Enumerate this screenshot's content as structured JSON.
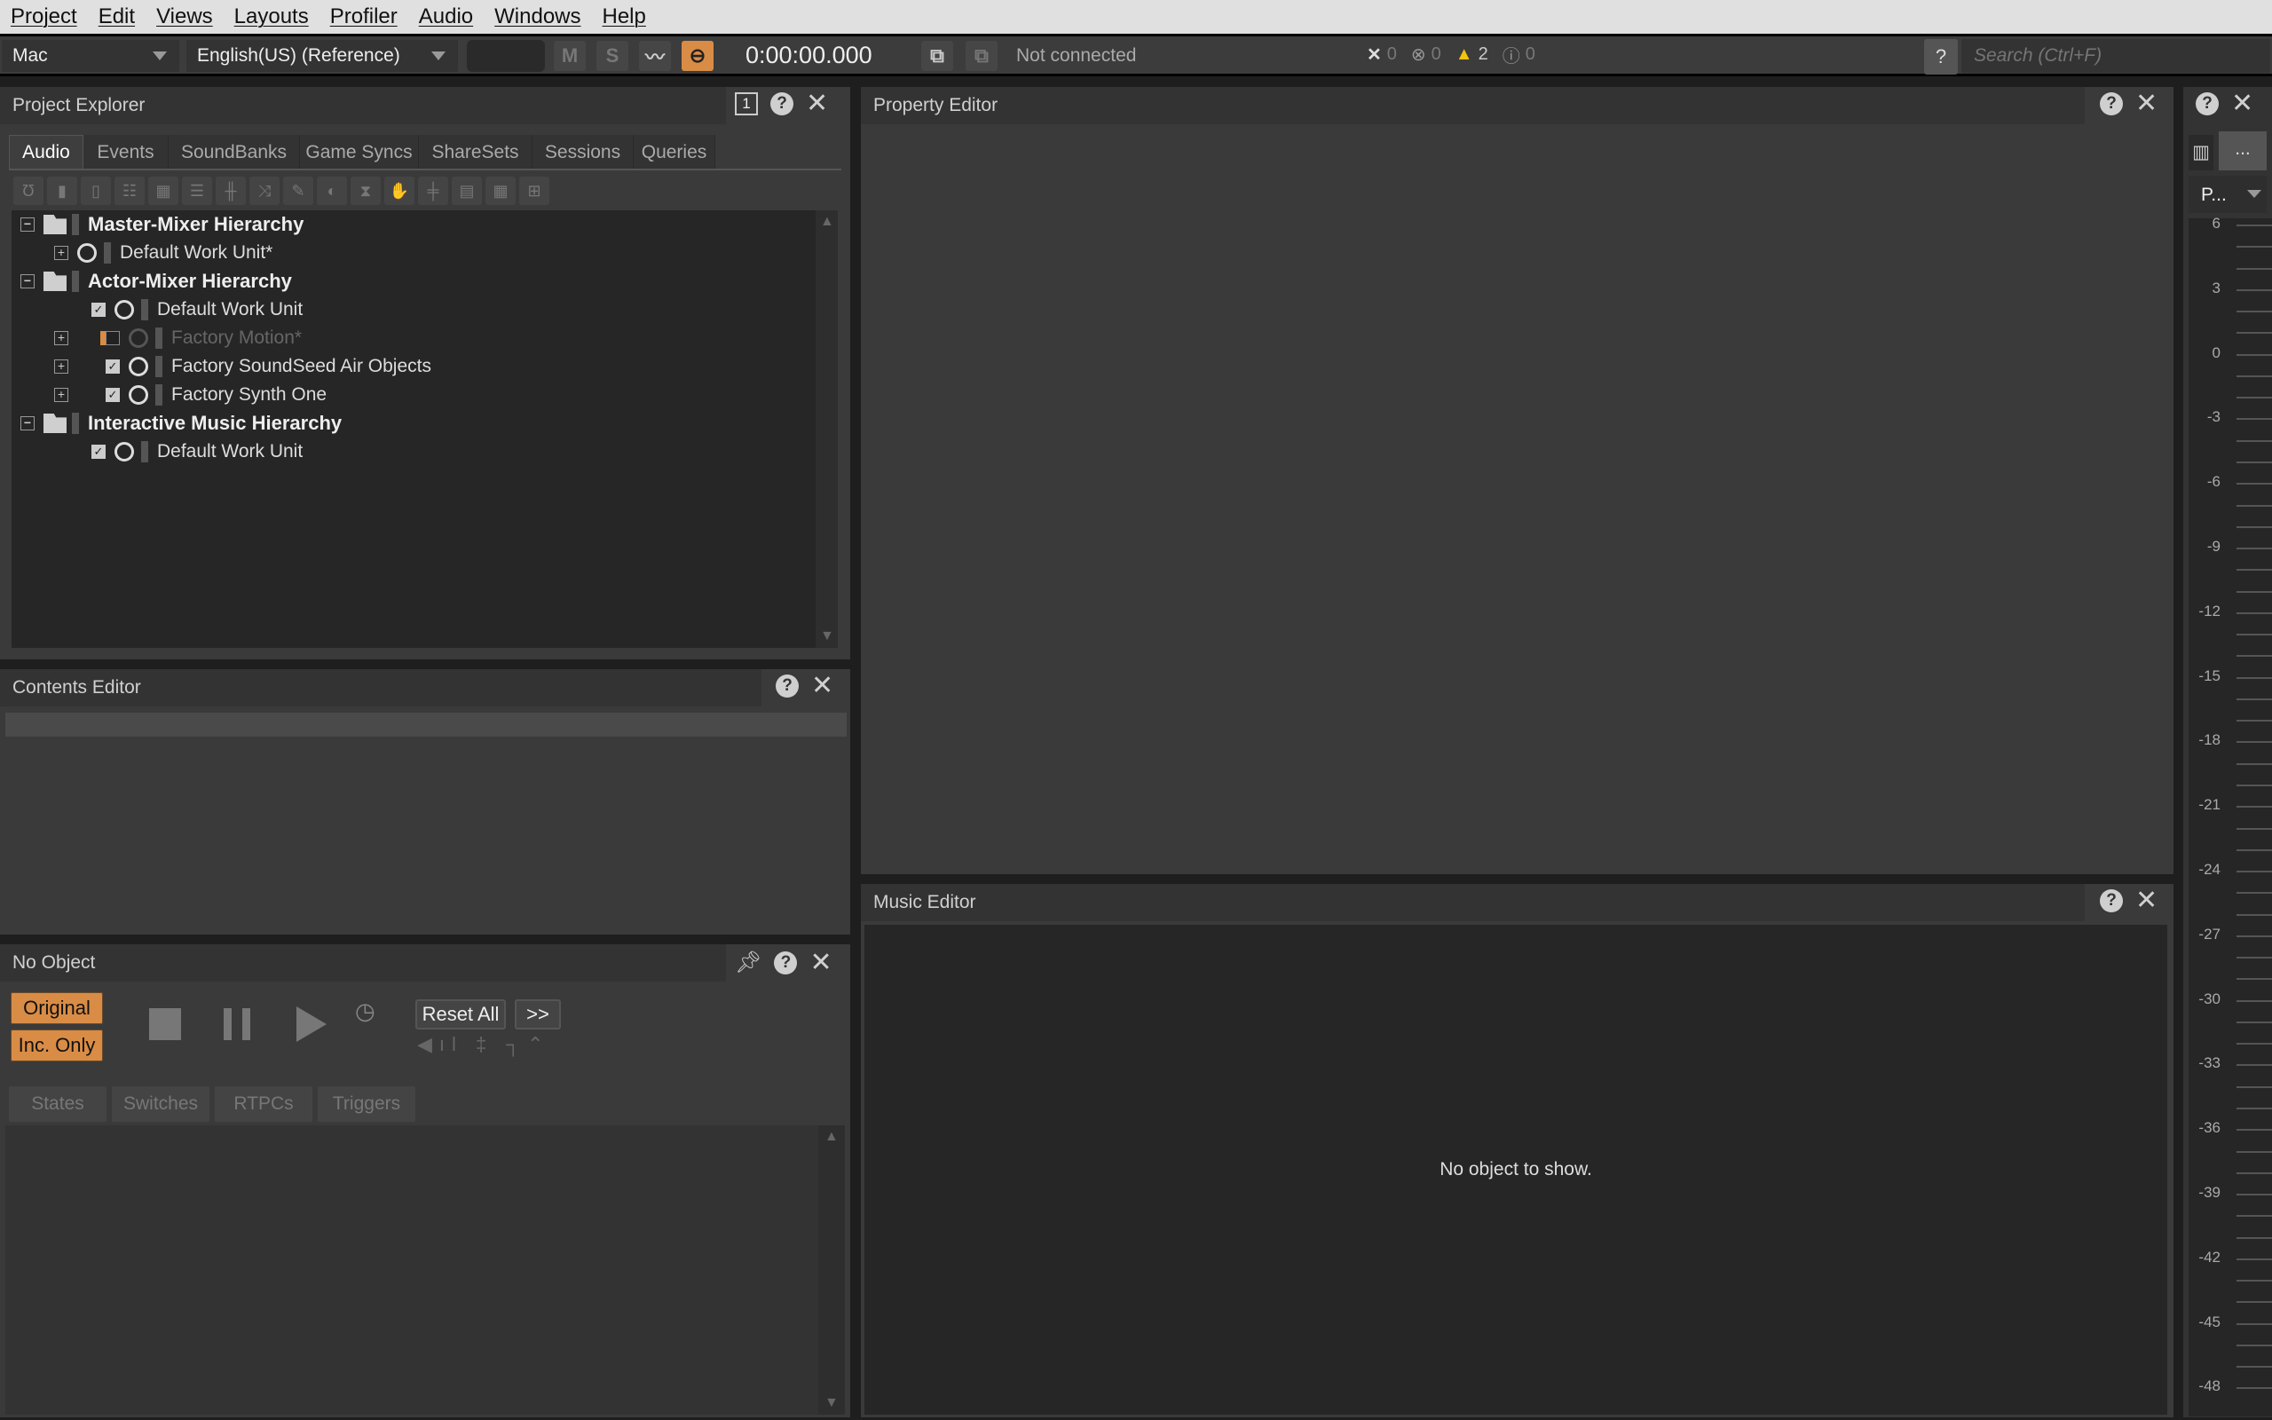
{
  "menu": [
    "Project",
    "Edit",
    "Views",
    "Layouts",
    "Profiler",
    "Audio",
    "Windows",
    "Help"
  ],
  "toolbar": {
    "platform": "Mac",
    "language": "English(US) (Reference)",
    "mute": "M",
    "solo": "S",
    "time": "0:00:00.000",
    "connection": "Not connected",
    "counts": {
      "errors_x": "0",
      "errors": "0",
      "warnings": "2",
      "info": "0"
    },
    "help": "?",
    "search_placeholder": "Search (Ctrl+F)",
    "accent": "#d98c45"
  },
  "project_explorer": {
    "title": "Project Explorer",
    "pin_number": "1",
    "tabs": [
      "Audio",
      "Events",
      "SoundBanks",
      "Game Syncs",
      "ShareSets",
      "Sessions",
      "Queries"
    ],
    "active_tab": "Audio",
    "tree": [
      {
        "label": "Master-Mixer Hierarchy",
        "level": 0,
        "type": "folder",
        "expanded": true
      },
      {
        "label": "Default Work Unit*",
        "level": 1,
        "type": "workunit",
        "expandable": true
      },
      {
        "label": "Actor-Mixer Hierarchy",
        "level": 0,
        "type": "folder",
        "expanded": true
      },
      {
        "label": "Default Work Unit",
        "level": 1,
        "type": "workunit",
        "checked": true
      },
      {
        "label": "Factory Motion*",
        "level": 1,
        "type": "workunit",
        "checked": false,
        "expandable": true,
        "disabled": true
      },
      {
        "label": "Factory SoundSeed Air Objects",
        "level": 1,
        "type": "workunit",
        "checked": true,
        "expandable": true
      },
      {
        "label": "Factory Synth One",
        "level": 1,
        "type": "workunit",
        "checked": true,
        "expandable": true
      },
      {
        "label": "Interactive Music Hierarchy",
        "level": 0,
        "type": "folder",
        "expanded": true
      },
      {
        "label": "Default Work Unit",
        "level": 1,
        "type": "workunit",
        "checked": true
      }
    ]
  },
  "contents_editor": {
    "title": "Contents Editor"
  },
  "transport": {
    "title": "No Object",
    "original": "Original",
    "inc_only": "Inc. Only",
    "reset_all": "Reset All",
    "more": ">>",
    "tabs": [
      "States",
      "Switches",
      "RTPCs",
      "Triggers"
    ]
  },
  "property_editor": {
    "title": "Property Editor"
  },
  "music_editor": {
    "title": "Music Editor",
    "empty": "No object to show."
  },
  "meter": {
    "dropdown": "P...",
    "more": "...",
    "scale": [
      "6",
      "3",
      "0",
      "-3",
      "-6",
      "-9",
      "-12",
      "-15",
      "-18",
      "-21",
      "-24",
      "-27",
      "-30",
      "-33",
      "-36",
      "-39",
      "-42",
      "-45",
      "-48"
    ]
  }
}
